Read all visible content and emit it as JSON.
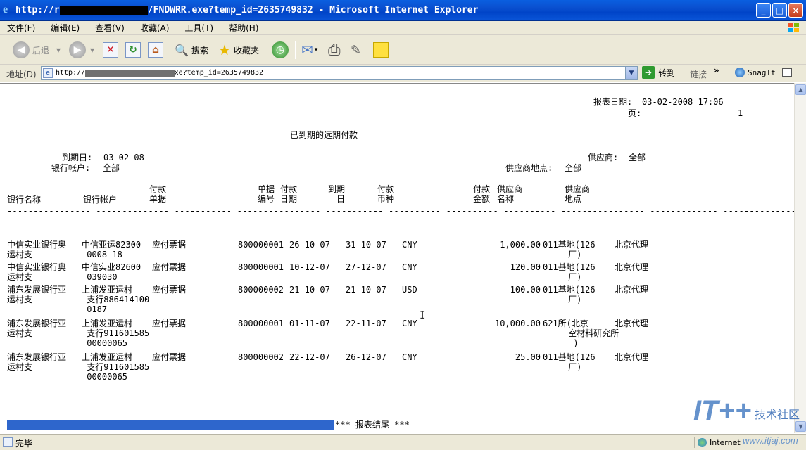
{
  "window": {
    "title": "http://r net:8006/OA_CGI/FNDWRR.exe?temp_id=2635749832 - Microsoft Internet Explorer",
    "controls": [
      "_",
      "□",
      "×"
    ]
  },
  "menu": [
    "文件(F)",
    "编辑(E)",
    "查看(V)",
    "收藏(A)",
    "工具(T)",
    "帮助(H)"
  ],
  "toolbar": {
    "back": "后退",
    "back_glyph": "◀",
    "forward_glyph": "▶",
    "stop_glyph": "✕",
    "refresh_glyph": "↻",
    "home_glyph": "⌂",
    "search": "搜索",
    "search_glyph": "🔍",
    "favorites": "收藏夹",
    "favorites_glyph": "★",
    "history_glyph": "◷",
    "mail_glyph": "✉",
    "print_glyph": "⎙",
    "edit_glyph": "✎",
    "discuss_glyph": "▭"
  },
  "address": {
    "label": "地址(D)",
    "url": "http://          6006/OA_CGI/FNDWRR.exe?temp_id=2635749832",
    "dropdown": "▼",
    "go": "转到",
    "go_glyph": "➔",
    "links": "链接",
    "links_more": "»",
    "snagit": "SnagIt"
  },
  "report": {
    "report_date_label": "报表日期:",
    "report_date": "03-02-2008 17:06",
    "page_label": "页:",
    "page": "1",
    "title": "已到期的远期付款",
    "due_date_label": "到期日:",
    "due_date": "03-02-08",
    "bank_account_label": "银行帐户:",
    "bank_account": "全部",
    "supplier_label": "供应商:",
    "supplier": "全部",
    "supplier_site_label": "供应商地点:",
    "supplier_site": "全部",
    "headers": {
      "bank_name": "银行名称",
      "bank_account": "银行帐户",
      "payment_doc": "付款\n单据",
      "doc_no": "单据\n编号",
      "payment_date": "付款\n日期",
      "due_date": "到期\n日",
      "payment_currency": "付款\n币种",
      "payment_amount": "付款\n金额",
      "supplier_name": "供应商\n名称",
      "supplier_site": "供应商\n地点"
    },
    "separator": "---------------- -------------- ----------- ---------------- ----------- ---------- ---------- ---------- ---------------- ------------- ---------------",
    "rows": [
      {
        "bank": "中信实业银行奥\n运村支",
        "account": "中信亚运82300\n 0008-18",
        "doc": "应付票据",
        "doc_no": "800000001",
        "pay_date": "26-10-07",
        "due": "31-10-07",
        "cur": "CNY",
        "amount": "1,000.00",
        "vendor": "011基地(126\n     厂)",
        "site": "北京代理"
      },
      {
        "bank": "中信实业银行奥\n运村支",
        "account": "中信实业82600\n 039030",
        "doc": "应付票据",
        "doc_no": "800000001",
        "pay_date": "10-12-07",
        "due": "27-12-07",
        "cur": "CNY",
        "amount": "120.00",
        "vendor": "011基地(126\n     厂)",
        "site": "北京代理"
      },
      {
        "bank": "浦东发展银行亚\n运村支",
        "account": "上浦发亚运村\n 支行886414100\n 0187",
        "doc": "应付票据",
        "doc_no": "800000002",
        "pay_date": "21-10-07",
        "due": "21-10-07",
        "cur": "USD",
        "amount": "100.00",
        "vendor": "011基地(126\n     厂)",
        "site": "北京代理"
      },
      {
        "bank": "浦东发展银行亚\n运村支",
        "account": "上浦发亚运村\n 支行911601585\n 00000065",
        "doc": "应付票据",
        "doc_no": "800000001",
        "pay_date": "01-11-07",
        "due": "22-11-07",
        "cur": "CNY",
        "amount": "10,000.00",
        "vendor": "621所(北京\n     空材料研究所\n      )",
        "site": "北京代理"
      },
      {
        "bank": "浦东发展银行亚\n运村支",
        "account": "上浦发亚运村\n 支行911601585\n 00000065",
        "doc": "应付票据",
        "doc_no": "800000002",
        "pay_date": "22-12-07",
        "due": "26-12-07",
        "cur": "CNY",
        "amount": "25.00",
        "vendor": "011基地(126\n     厂)",
        "site": "北京代理"
      }
    ],
    "footer": "*** 报表结尾 ***"
  },
  "status": {
    "text": "完毕",
    "zone": "Internet"
  },
  "watermark": {
    "logo": "IT++",
    "text": "技术社区",
    "url": "www.itjaj.com"
  },
  "colors": {
    "titlebar": "#0a4fcf",
    "chrome": "#ece9d8",
    "progress": "#3a6fd0"
  }
}
